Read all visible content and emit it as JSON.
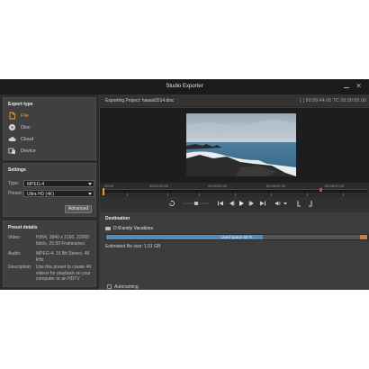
{
  "window": {
    "title": "Studio Exporter"
  },
  "export_type": {
    "title": "Export type",
    "items": [
      {
        "label": "File",
        "icon": "file-icon",
        "active": true
      },
      {
        "label": "Disc",
        "icon": "disc-icon",
        "active": false
      },
      {
        "label": "Cloud",
        "icon": "cloud-icon",
        "active": false
      },
      {
        "label": "Device",
        "icon": "device-icon",
        "active": false
      }
    ]
  },
  "settings": {
    "title": "Settings",
    "type_label": "Type:",
    "type_value": "MPEG-4",
    "preset_label": "Preset:",
    "preset_value": "Ultra HD (4K)",
    "advanced_label": "Advanced"
  },
  "preset_details": {
    "title": "Preset details",
    "video_label": "Video:",
    "video_value": "H264, 3840 x 2160, 22000 kbit/s, 25.00 Frames/sec",
    "audio_label": "Audio:",
    "audio_value": "MPEG-4, 16 Bit Stereo, 48 kHz",
    "description_label": "Description:",
    "description_value": "Use this preset to create 4K videos for playback on your computer or an HDTV"
  },
  "player": {
    "exporting_label": "Exporting Project: hawaii2014.disc",
    "timecode": "[ ] 00:09:44.00   TC 00:00:00.00",
    "timeline_labels": [
      "00:00",
      "00:02:00.00",
      "00:04:00.00",
      "00:06:00.00",
      "00:08:00.00"
    ]
  },
  "destination": {
    "title": "Destination",
    "path": "D:\\Family Vacations",
    "used_space_label": "Used space 60 %",
    "used_space_fraction": 0.6,
    "estimated_size": "Estimated file size: 1.51 GB",
    "autonaming_label": "Autonaming"
  },
  "colors": {
    "accent": "#f0a040",
    "bar_fill": "#4f8dc0",
    "background": "#3a3a3a"
  }
}
